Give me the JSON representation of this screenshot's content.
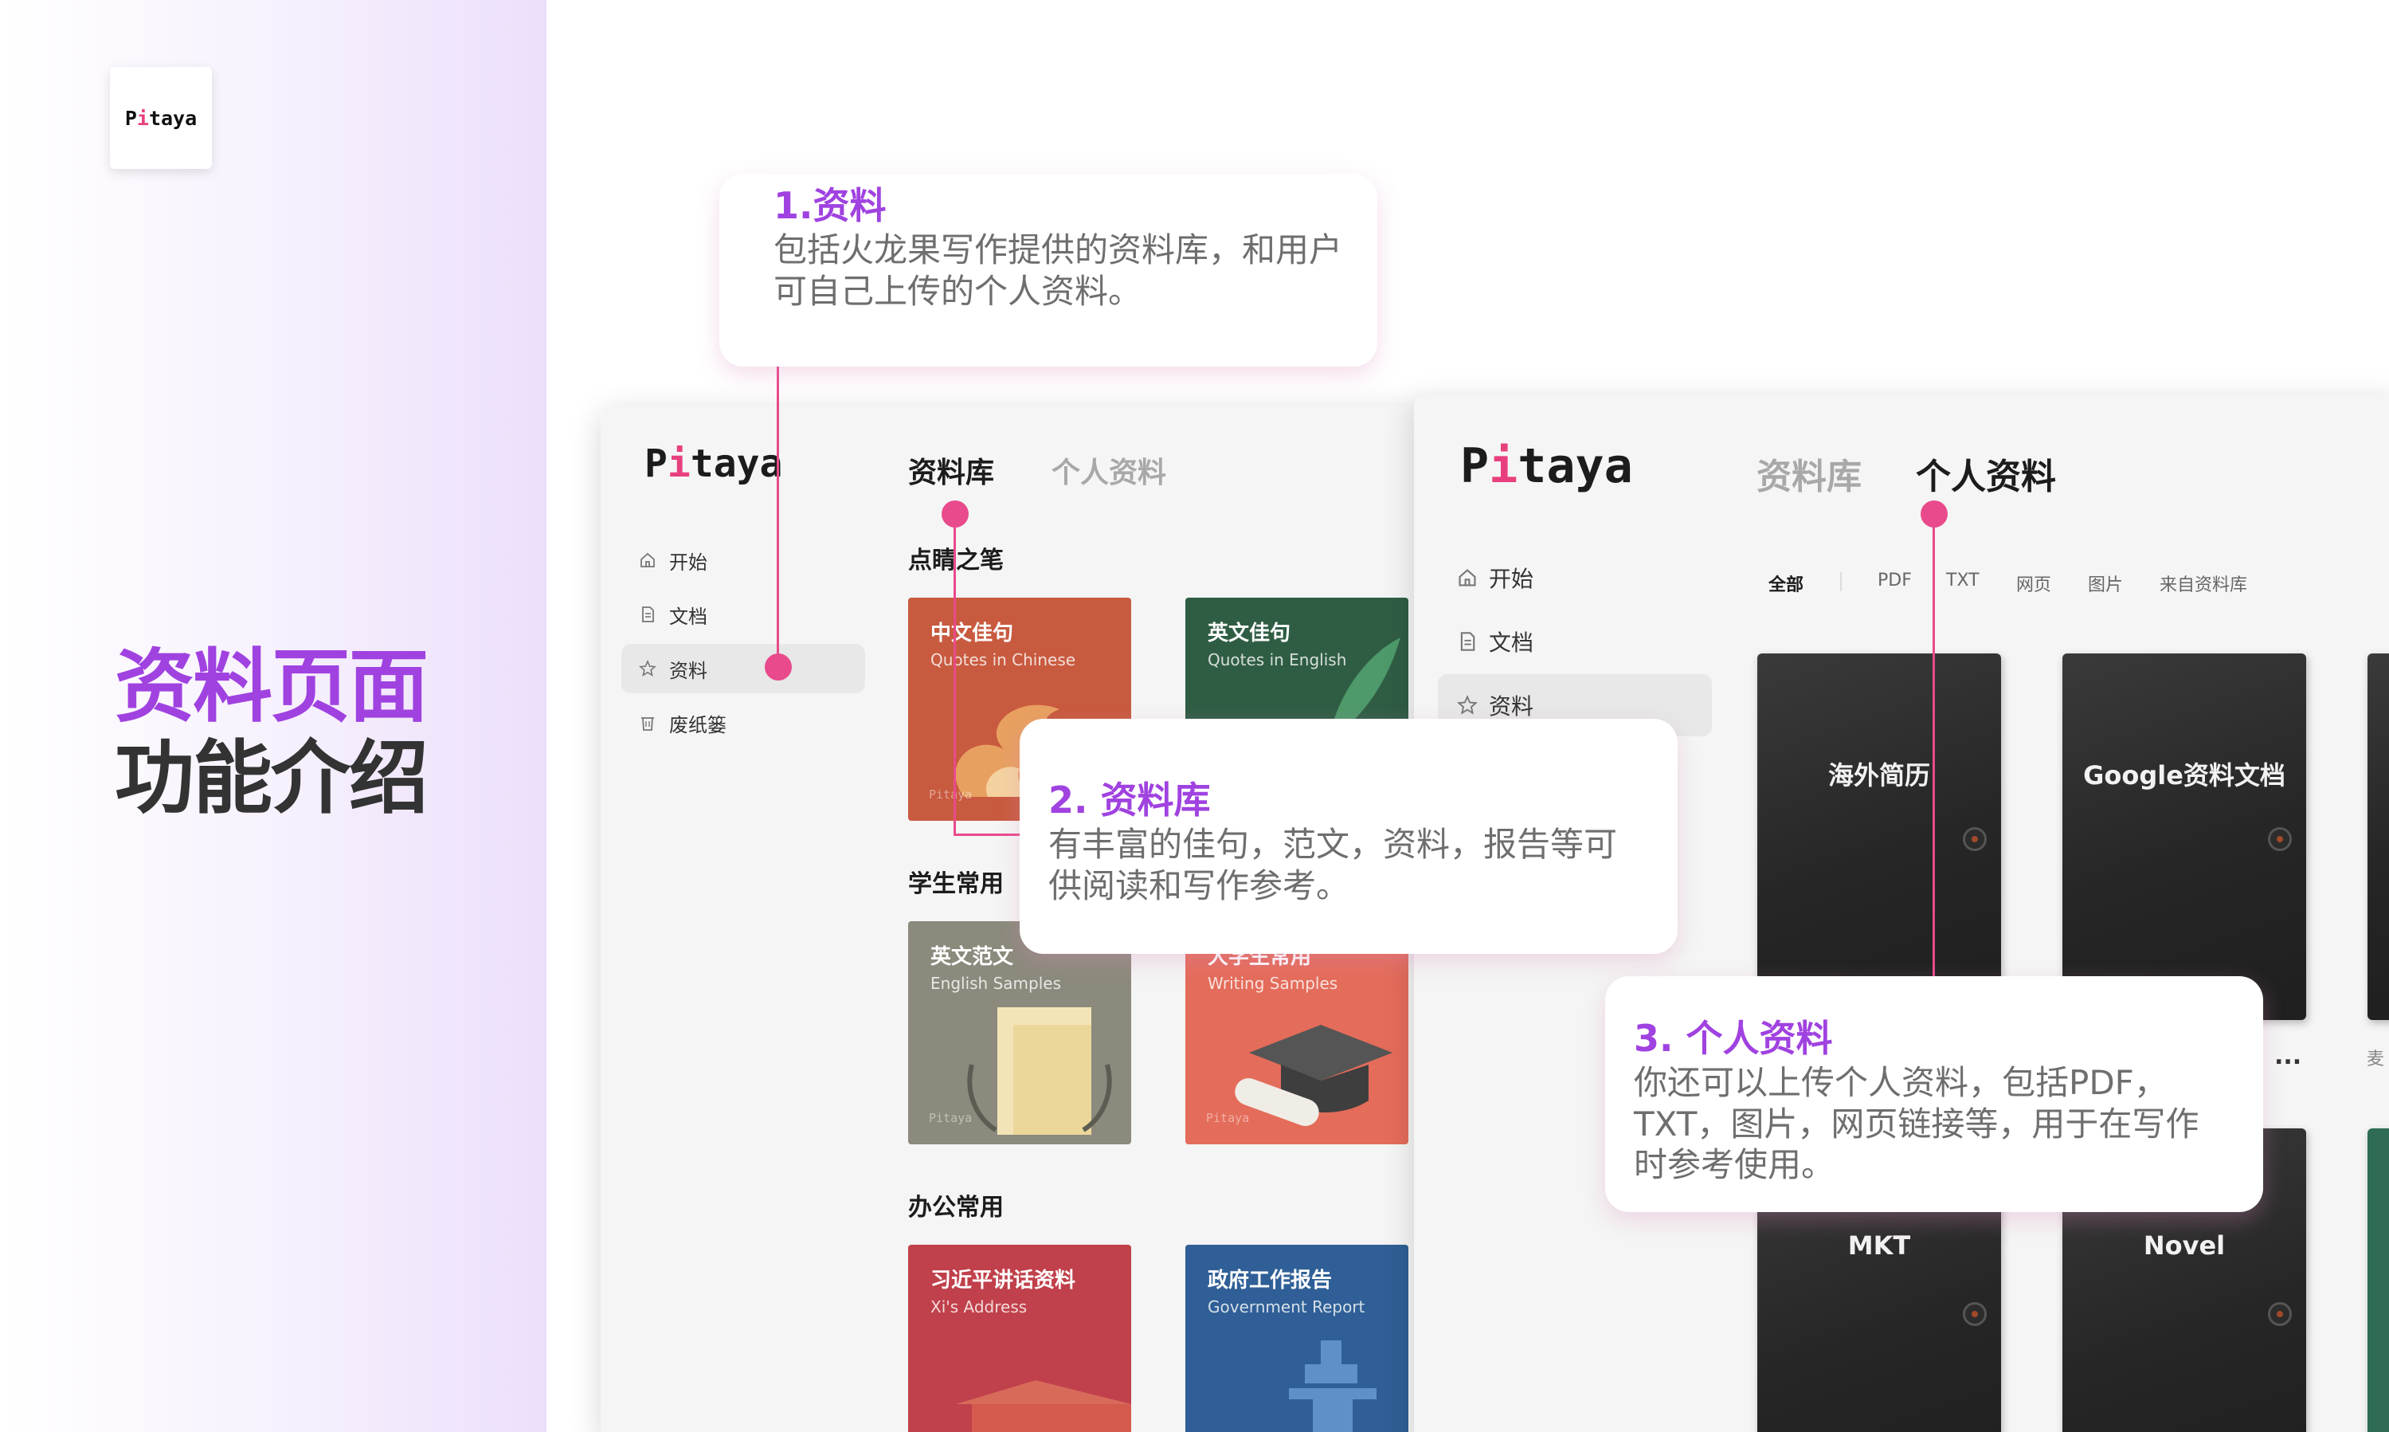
{
  "brand": {
    "logo_p": "P",
    "logo_i": "i",
    "logo_rest": "taya"
  },
  "page_title": {
    "line1": "资料页面",
    "line2": "功能介绍"
  },
  "window_library": {
    "tabs": [
      "资料库",
      "个人资料"
    ],
    "nav": [
      "开始",
      "文档",
      "资料",
      "废纸篓"
    ],
    "sections": [
      "点睛之笔",
      "学生常用",
      "办公常用"
    ],
    "cards": [
      {
        "title": "中文佳句",
        "subtitle": "Quotes in Chinese",
        "watermark": "Pitaya",
        "color": "#c85a3f"
      },
      {
        "title": "英文佳句",
        "subtitle": "Quotes in English",
        "watermark": "",
        "color": "#2f5d44"
      },
      {
        "title": "英文范文",
        "subtitle": "English Samples",
        "watermark": "Pitaya",
        "color": "#8b8a7c"
      },
      {
        "title": "大学生常用",
        "subtitle": "Writing Samples",
        "watermark": "Pitaya",
        "color": "#e46c5a"
      },
      {
        "title": "习近平讲话资料",
        "subtitle": "Xi's Address",
        "watermark": "",
        "color": "#c0404b"
      },
      {
        "title": "政府工作报告",
        "subtitle": "Government Report",
        "watermark": "",
        "color": "#2f5f96"
      }
    ]
  },
  "window_personal": {
    "tabs": [
      "资料库",
      "个人资料"
    ],
    "nav": [
      "开始",
      "文档",
      "资料"
    ],
    "filters": [
      "全部",
      "PDF",
      "TXT",
      "网页",
      "图片",
      "来自资料库"
    ],
    "books": [
      "海外简历",
      "Google资料文档",
      "MKT",
      "Novel"
    ],
    "more": "...",
    "edge_text": "麦"
  },
  "callouts": [
    {
      "heading": "1.资料",
      "body": "包括火龙果写作提供的资料库，和用户可自己上传的个人资料。"
    },
    {
      "heading": "2. 资料库",
      "body": "有丰富的佳句，范文，资料，报告等可供阅读和写作参考。"
    },
    {
      "heading": "3. 个人资料",
      "body": "你还可以上传个人资料，包括PDF，TXT，图片，网页链接等，用于在写作时参考使用。"
    }
  ],
  "colors": {
    "accent_purple": "#a042e0",
    "accent_pink": "#e94a8c",
    "title_dark": "#333333"
  }
}
